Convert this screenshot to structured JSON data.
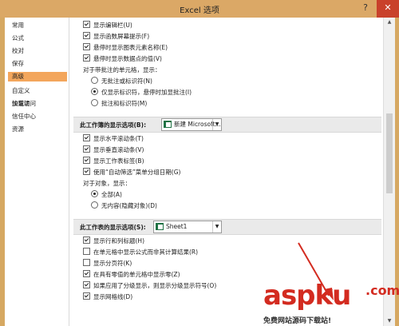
{
  "window": {
    "title": "Excel 选项",
    "help_glyph": "?",
    "close_glyph": "✕"
  },
  "sidebar": {
    "items": [
      {
        "label": "常用"
      },
      {
        "label": "公式"
      },
      {
        "label": "校对"
      },
      {
        "label": "保存"
      },
      {
        "label": "语言"
      },
      {
        "label": "高级",
        "active": true
      },
      {
        "label": "自定义"
      },
      {
        "label": "快速访问"
      },
      {
        "label": "加载项"
      },
      {
        "label": "信任中心"
      },
      {
        "label": "资源"
      }
    ]
  },
  "display_options": [
    {
      "label": "显示编辑栏(U)",
      "checked": true
    },
    {
      "label": "显示函数屏幕提示(F)",
      "checked": true
    },
    {
      "label": "悬停时显示图表元素名称(E)",
      "checked": true
    },
    {
      "label": "悬停时显示数据点的值(V)",
      "checked": true
    }
  ],
  "comments_label": "对于带批注的单元格，显示：",
  "comments_options": [
    {
      "label": "无批注或标识符(N)",
      "selected": false
    },
    {
      "label": "仅显示标识符，悬停时加显批注(I)",
      "selected": true
    },
    {
      "label": "批注和标识符(M)",
      "selected": false
    }
  ],
  "workbook_section": {
    "title": "此工作簿的显示选项(B):",
    "selector": "新建 Microsoft..."
  },
  "workbook_options": [
    {
      "label": "显示水平滚动条(T)",
      "checked": true
    },
    {
      "label": "显示垂直滚动条(V)",
      "checked": true
    },
    {
      "label": "显示工作表标签(B)",
      "checked": true
    },
    {
      "label": "使用“自动筛选”菜单分组日期(G)",
      "checked": true
    }
  ],
  "objects_label": "对于对象，显示：",
  "objects_options": [
    {
      "label": "全部(A)",
      "selected": true
    },
    {
      "label": "无内容(隐藏对象)(D)",
      "selected": false
    }
  ],
  "worksheet_section": {
    "title": "此工作表的显示选项(S):",
    "selector": "Sheet1"
  },
  "worksheet_options": [
    {
      "label": "显示行和列标题(H)",
      "checked": true
    },
    {
      "label": "在单元格中显示公式而非其计算结果(R)",
      "checked": false
    },
    {
      "label": "显示分页符(K)",
      "checked": false
    },
    {
      "label": "在具有零值的单元格中显示零(Z)",
      "checked": true
    },
    {
      "label": "如果应用了分级显示，则显示分级显示符号(O)",
      "checked": true
    },
    {
      "label": "显示网格线(D)",
      "checked": true
    }
  ],
  "watermark": {
    "brand": "aspku",
    "suffix": ".com",
    "tagline": "免费网站源码下载站!"
  },
  "colors": {
    "titlebar": "#dba866",
    "active_item": "#f3a65c",
    "annotation": "#d32b20"
  }
}
